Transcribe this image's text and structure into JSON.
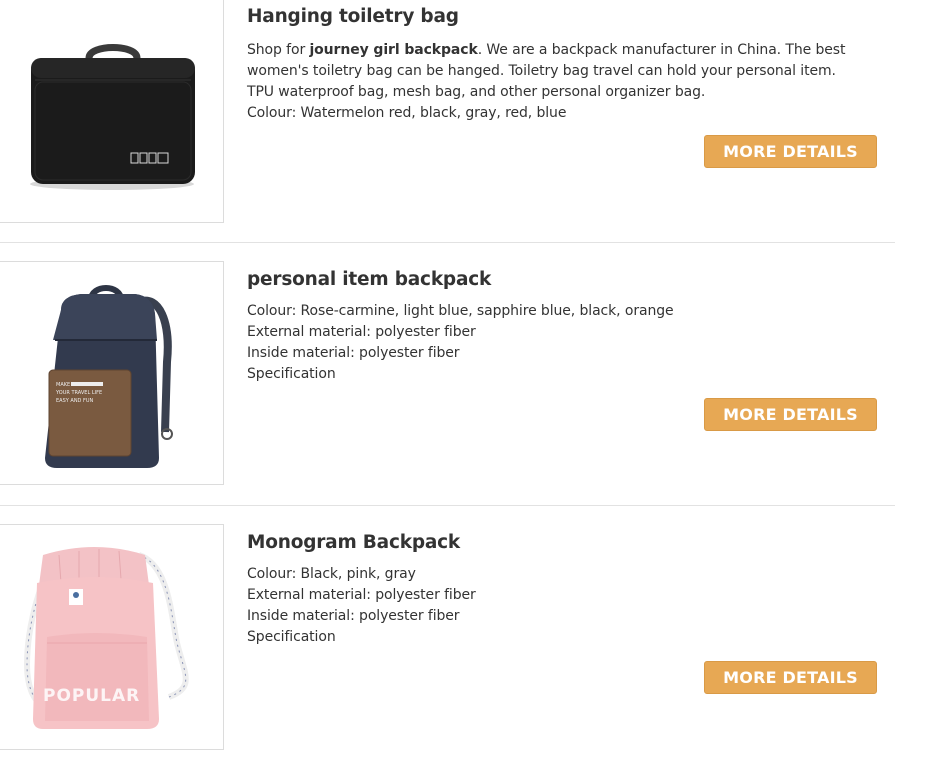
{
  "products": [
    {
      "title": "Hanging toiletry bag",
      "desc_prefix": "Shop for ",
      "desc_bold": "journey girl backpack",
      "desc_suffix": ". We are a backpack manufacturer in China. The best",
      "lines": [
        "women's toiletry bag can be hanged. Toiletry bag travel can hold your personal item.",
        "TPU waterproof bag, mesh bag, and other personal organizer bag.",
        "Colour: Watermelon red, black, gray, red, blue"
      ],
      "button": "MORE DETAILS",
      "image_text": ""
    },
    {
      "title": "personal item backpack",
      "lines": [
        "Colour: Rose-carmine, light blue, sapphire blue, black, orange",
        "External material: polyester fiber",
        "Inside material: polyester fiber",
        "Specification"
      ],
      "button": "MORE DETAILS",
      "image_text": [
        "MAKE",
        "YOUR TRAVEL LIFE",
        "EASY AND FUN"
      ]
    },
    {
      "title": "Monogram Backpack",
      "lines": [
        "Colour: Black, pink, gray",
        "External material: polyester fiber",
        "Inside material: polyester fiber",
        "Specification"
      ],
      "button": "MORE DETAILS",
      "image_text": "POPULAR"
    }
  ],
  "colors": {
    "button_bg": "#e7a854",
    "button_text": "#ffffff",
    "divider": "#e2e2e2",
    "text": "#333333"
  }
}
